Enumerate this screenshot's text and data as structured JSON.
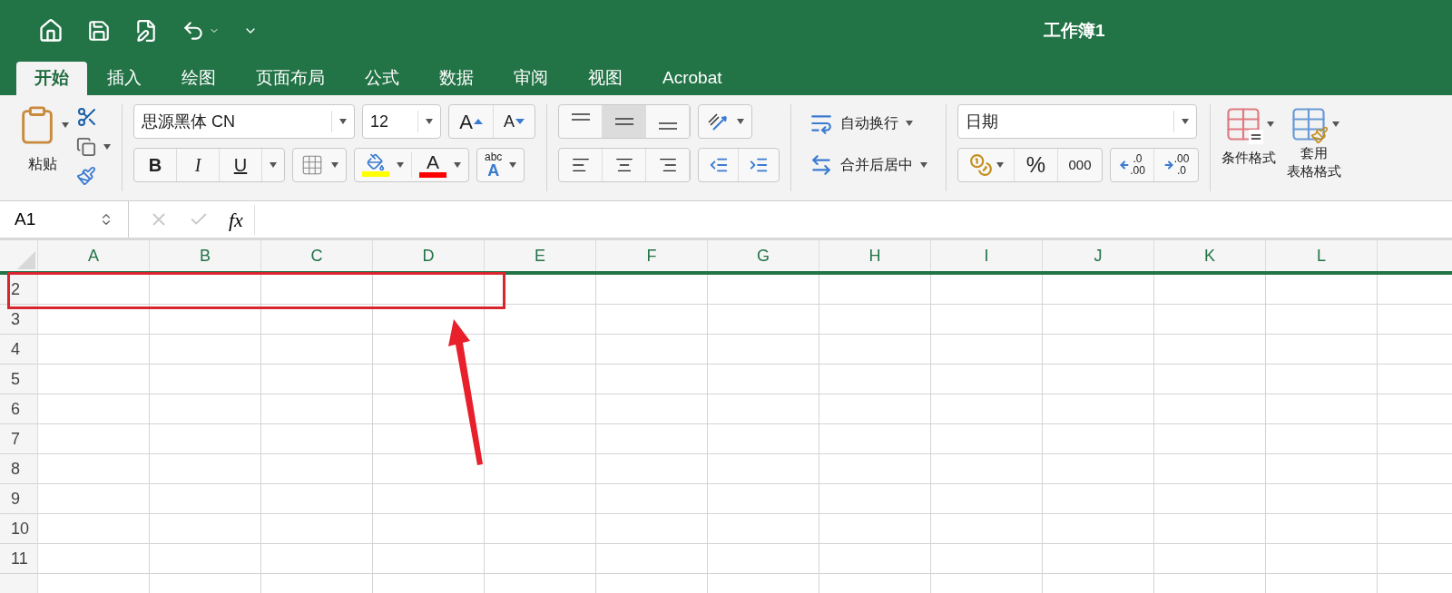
{
  "window": {
    "title": "工作簿1"
  },
  "tabs": [
    {
      "label": "开始",
      "selected": true
    },
    {
      "label": "插入",
      "selected": false
    },
    {
      "label": "绘图",
      "selected": false
    },
    {
      "label": "页面布局",
      "selected": false
    },
    {
      "label": "公式",
      "selected": false
    },
    {
      "label": "数据",
      "selected": false
    },
    {
      "label": "审阅",
      "selected": false
    },
    {
      "label": "视图",
      "selected": false
    },
    {
      "label": "Acrobat",
      "selected": false
    }
  ],
  "ribbon": {
    "paste_label": "粘贴",
    "font_name": "思源黑体 CN",
    "font_size": "12",
    "grow_font": "A",
    "shrink_font": "A",
    "styles": [
      {
        "kind": "bold",
        "label": "B"
      },
      {
        "kind": "italic",
        "label": "I"
      },
      {
        "kind": "underline",
        "label": "U"
      }
    ],
    "fill_color": {
      "color": "#ffff00"
    },
    "font_color": {
      "label": "A",
      "color": "#ff0000"
    },
    "text_effects": {
      "top": "abc",
      "bottom": "A"
    },
    "vertical_align": [
      {
        "kind": "top",
        "selected": false
      },
      {
        "kind": "middle",
        "selected": true
      },
      {
        "kind": "bottom",
        "selected": false
      }
    ],
    "horizontal_align": [
      {
        "kind": "left",
        "selected": false
      },
      {
        "kind": "center",
        "selected": false
      },
      {
        "kind": "right",
        "selected": false
      }
    ],
    "wrap_text": "自动换行",
    "merge_center": "合并后居中",
    "number_format": "日期",
    "percent": "%",
    "comma": "000",
    "increase_decimal": {
      "top": ".0",
      "bottom": ".00"
    },
    "decrease_decimal": {
      "top": ".00",
      "bottom": ".0"
    },
    "conditional_format": "条件格式",
    "table_format": [
      "套用",
      "表格格式"
    ]
  },
  "formula_bar": {
    "name_box": "A1",
    "fx": "fx"
  },
  "sheet": {
    "columns": [
      "A",
      "B",
      "C",
      "D",
      "E",
      "F",
      "G",
      "H",
      "I",
      "J",
      "K",
      "L"
    ],
    "rows": [
      "2",
      "3",
      "4",
      "5",
      "6",
      "7",
      "8",
      "9",
      "10",
      "11"
    ]
  }
}
